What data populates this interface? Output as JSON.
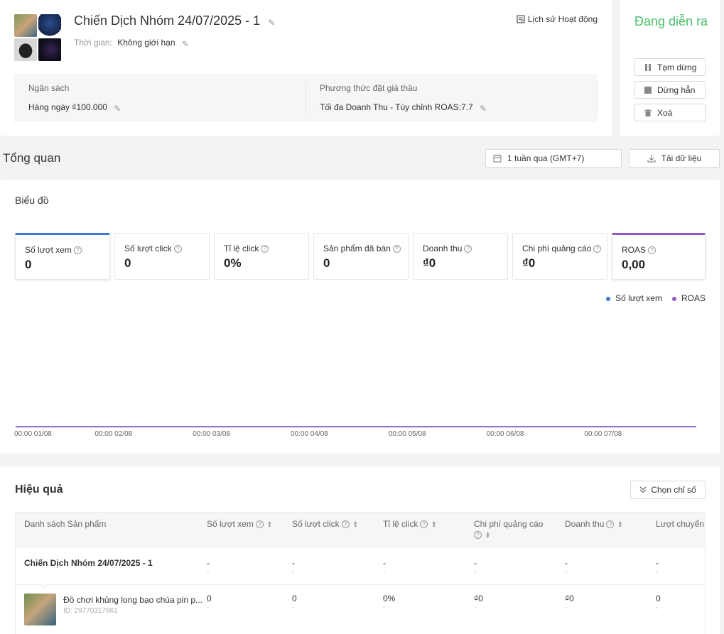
{
  "campaign": {
    "title": "Chiến Dịch Nhóm 24/07/2025 - 1",
    "time_label": "Thời gian:",
    "time_value": "Không giới hạn",
    "history_label": "Lịch sử Hoạt động",
    "budget_label": "Ngân sách",
    "budget_value": "Hàng ngày ₫100.000",
    "bid_label": "Phương thức đặt giá thầu",
    "bid_value": "Tối đa Doanh Thu - Tùy chỉnh ROAS:7.7"
  },
  "status": {
    "text": "Đang diễn ra",
    "color": "#4cbe6c",
    "pause_label": "Tạm dừng",
    "stop_label": "Dừng hẳn",
    "delete_label": "Xoá"
  },
  "overview": {
    "title": "Tổng quan",
    "date_range": "1 tuần qua (GMT+7)",
    "download_label": "Tải dữ liệu"
  },
  "chart_section": {
    "title": "Biểu đồ",
    "metrics": [
      {
        "label": "Số lượt xem",
        "value": "0"
      },
      {
        "label": "Số lượt click",
        "value": "0"
      },
      {
        "label": "Tỉ lệ click",
        "value": "0%"
      },
      {
        "label": "Sản phẩm đã bán",
        "value": "0"
      },
      {
        "label": "Doanh thu",
        "value": "₫0"
      },
      {
        "label": "Chi phí quảng cáo",
        "value": "₫0"
      },
      {
        "label": "ROAS",
        "value": "0,00"
      }
    ],
    "legend": [
      {
        "name": "Số lượt xem",
        "color": "#3b7bd1"
      },
      {
        "name": "ROAS",
        "color": "#8e5cc4"
      }
    ]
  },
  "chart_data": {
    "type": "line",
    "x": [
      "00:00 01/08",
      "00:00 02/08",
      "00:00 03/08",
      "00:00 04/08",
      "00:00 05/08",
      "00:00 06/08",
      "00:00 07/08"
    ],
    "series": [
      {
        "name": "Số lượt xem",
        "values": [
          0,
          0,
          0,
          0,
          0,
          0,
          0
        ],
        "color": "#3b7bd1"
      },
      {
        "name": "ROAS",
        "values": [
          0,
          0,
          0,
          0,
          0,
          0,
          0
        ],
        "color": "#8e5cc4"
      }
    ],
    "title": "Biểu đồ",
    "legend_position": "top-right",
    "grid": false
  },
  "performance": {
    "title": "Hiệu quả",
    "pick_label": "Chọn chỉ số",
    "columns": [
      "Danh sách Sản phẩm",
      "Số lượt xem",
      "Số lượt click",
      "Tỉ lệ click",
      "Chi phí quảng cáo",
      "Doanh thu",
      "Lượt chuyển đ"
    ],
    "campaign_row": {
      "name": "Chiến Dịch Nhóm 24/07/2025 - 1",
      "values": [
        "-",
        "-",
        "-",
        "-",
        "-",
        "-"
      ],
      "subs": [
        "-",
        "-",
        "-",
        "-",
        "-",
        "-"
      ]
    },
    "product_row": {
      "name": "Đồ chơi khủng long bạo chúa pin p...",
      "id": "ID: 29770317861",
      "values": [
        "0",
        "0",
        "0%",
        "₫0",
        "₫0",
        "0"
      ],
      "subs": [
        "-",
        "-",
        "-",
        "-",
        "-",
        "-"
      ]
    }
  }
}
